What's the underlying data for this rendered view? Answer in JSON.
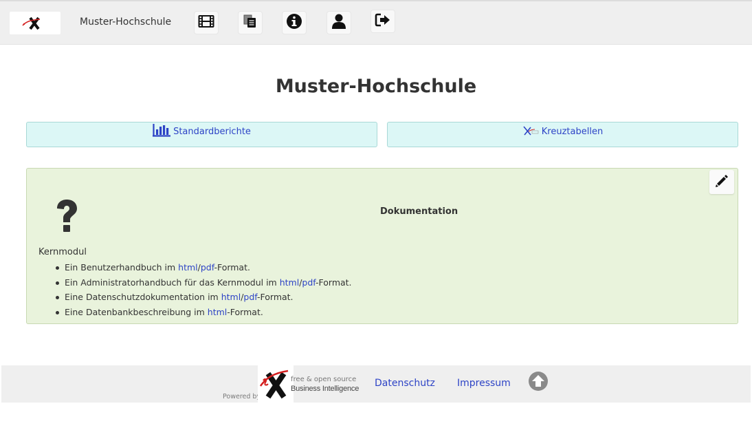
{
  "header": {
    "brand": "Muster-Hochschule",
    "nav_icons": [
      "film-icon",
      "copy-documents-icon",
      "info-icon",
      "user-icon",
      "logout-icon"
    ]
  },
  "page": {
    "title": "Muster-Hochschule"
  },
  "buttons": {
    "standard_reports": "Standardberichte",
    "cross_tables": "Kreuztabellen"
  },
  "documentation": {
    "heading": "Dokumentation",
    "section": "Kernmodul",
    "items": [
      {
        "pre": "Ein Benutzerhandbuch im ",
        "html": "html",
        "sep": "/",
        "pdf": "pdf",
        "post": "-Format."
      },
      {
        "pre": "Ein Administratorhandbuch für das Kernmodul im ",
        "html": "html",
        "sep": "/",
        "pdf": "pdf",
        "post": "-Format."
      },
      {
        "pre": "Eine Datenschutzdokumentation im ",
        "html": "html",
        "sep": "/",
        "pdf": "pdf",
        "post": "-Format."
      },
      {
        "pre": "Eine Datenbankbeschreibung im ",
        "html": "html",
        "post": "-Format."
      }
    ]
  },
  "footer": {
    "powered_by": "Powered by",
    "tagline": "free & open source",
    "product": "Business Intelligence",
    "privacy": "Datenschutz",
    "imprint": "Impressum"
  },
  "colors": {
    "link": "#2d43c6",
    "button_bg": "#dcf7f6",
    "panel_bg": "#e9f3dc",
    "logo_red": "#d42020"
  }
}
